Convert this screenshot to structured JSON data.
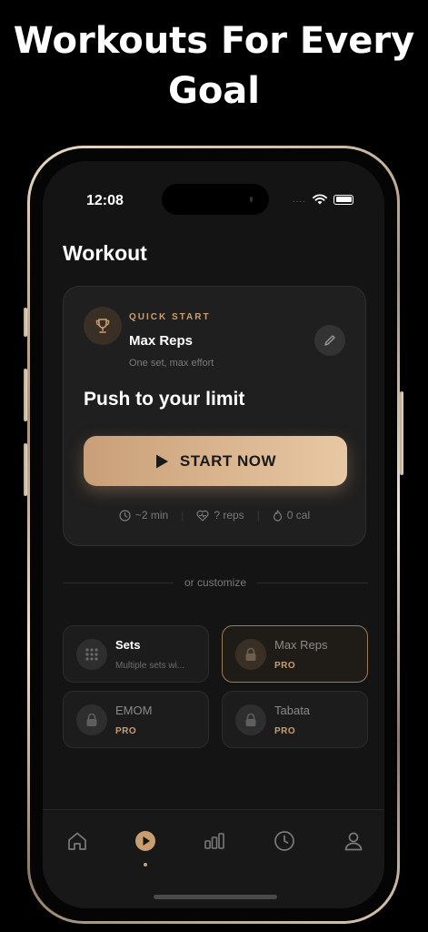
{
  "promo": {
    "headline": "Workouts For Every Goal"
  },
  "status_bar": {
    "time": "12:08",
    "dots": "...."
  },
  "page": {
    "title": "Workout"
  },
  "quick_start": {
    "label": "QUICK START",
    "name": "Max Reps",
    "description": "One set, max effort",
    "tagline": "Push to your limit",
    "start_label": "START NOW",
    "stats": {
      "duration": "~2 min",
      "reps": "? reps",
      "calories": "0 cal"
    },
    "icon": "trophy-icon"
  },
  "divider": {
    "text": "or customize"
  },
  "modes": [
    {
      "name": "Sets",
      "subtitle": "Multiple sets wi...",
      "icon": "grid-icon"
    },
    {
      "name": "Max Reps",
      "badge": "PRO",
      "icon": "lock-icon"
    },
    {
      "name": "EMOM",
      "badge": "PRO",
      "icon": "lock-icon"
    },
    {
      "name": "Tabata",
      "badge": "PRO",
      "icon": "lock-icon"
    }
  ],
  "tabbar": {
    "items": [
      "home-icon",
      "play-icon",
      "stats-icon",
      "clock-icon",
      "profile-icon"
    ],
    "active": "play-icon"
  },
  "colors": {
    "accent": "#c99d72",
    "background": "#141414",
    "card": "#1f1f1f"
  }
}
